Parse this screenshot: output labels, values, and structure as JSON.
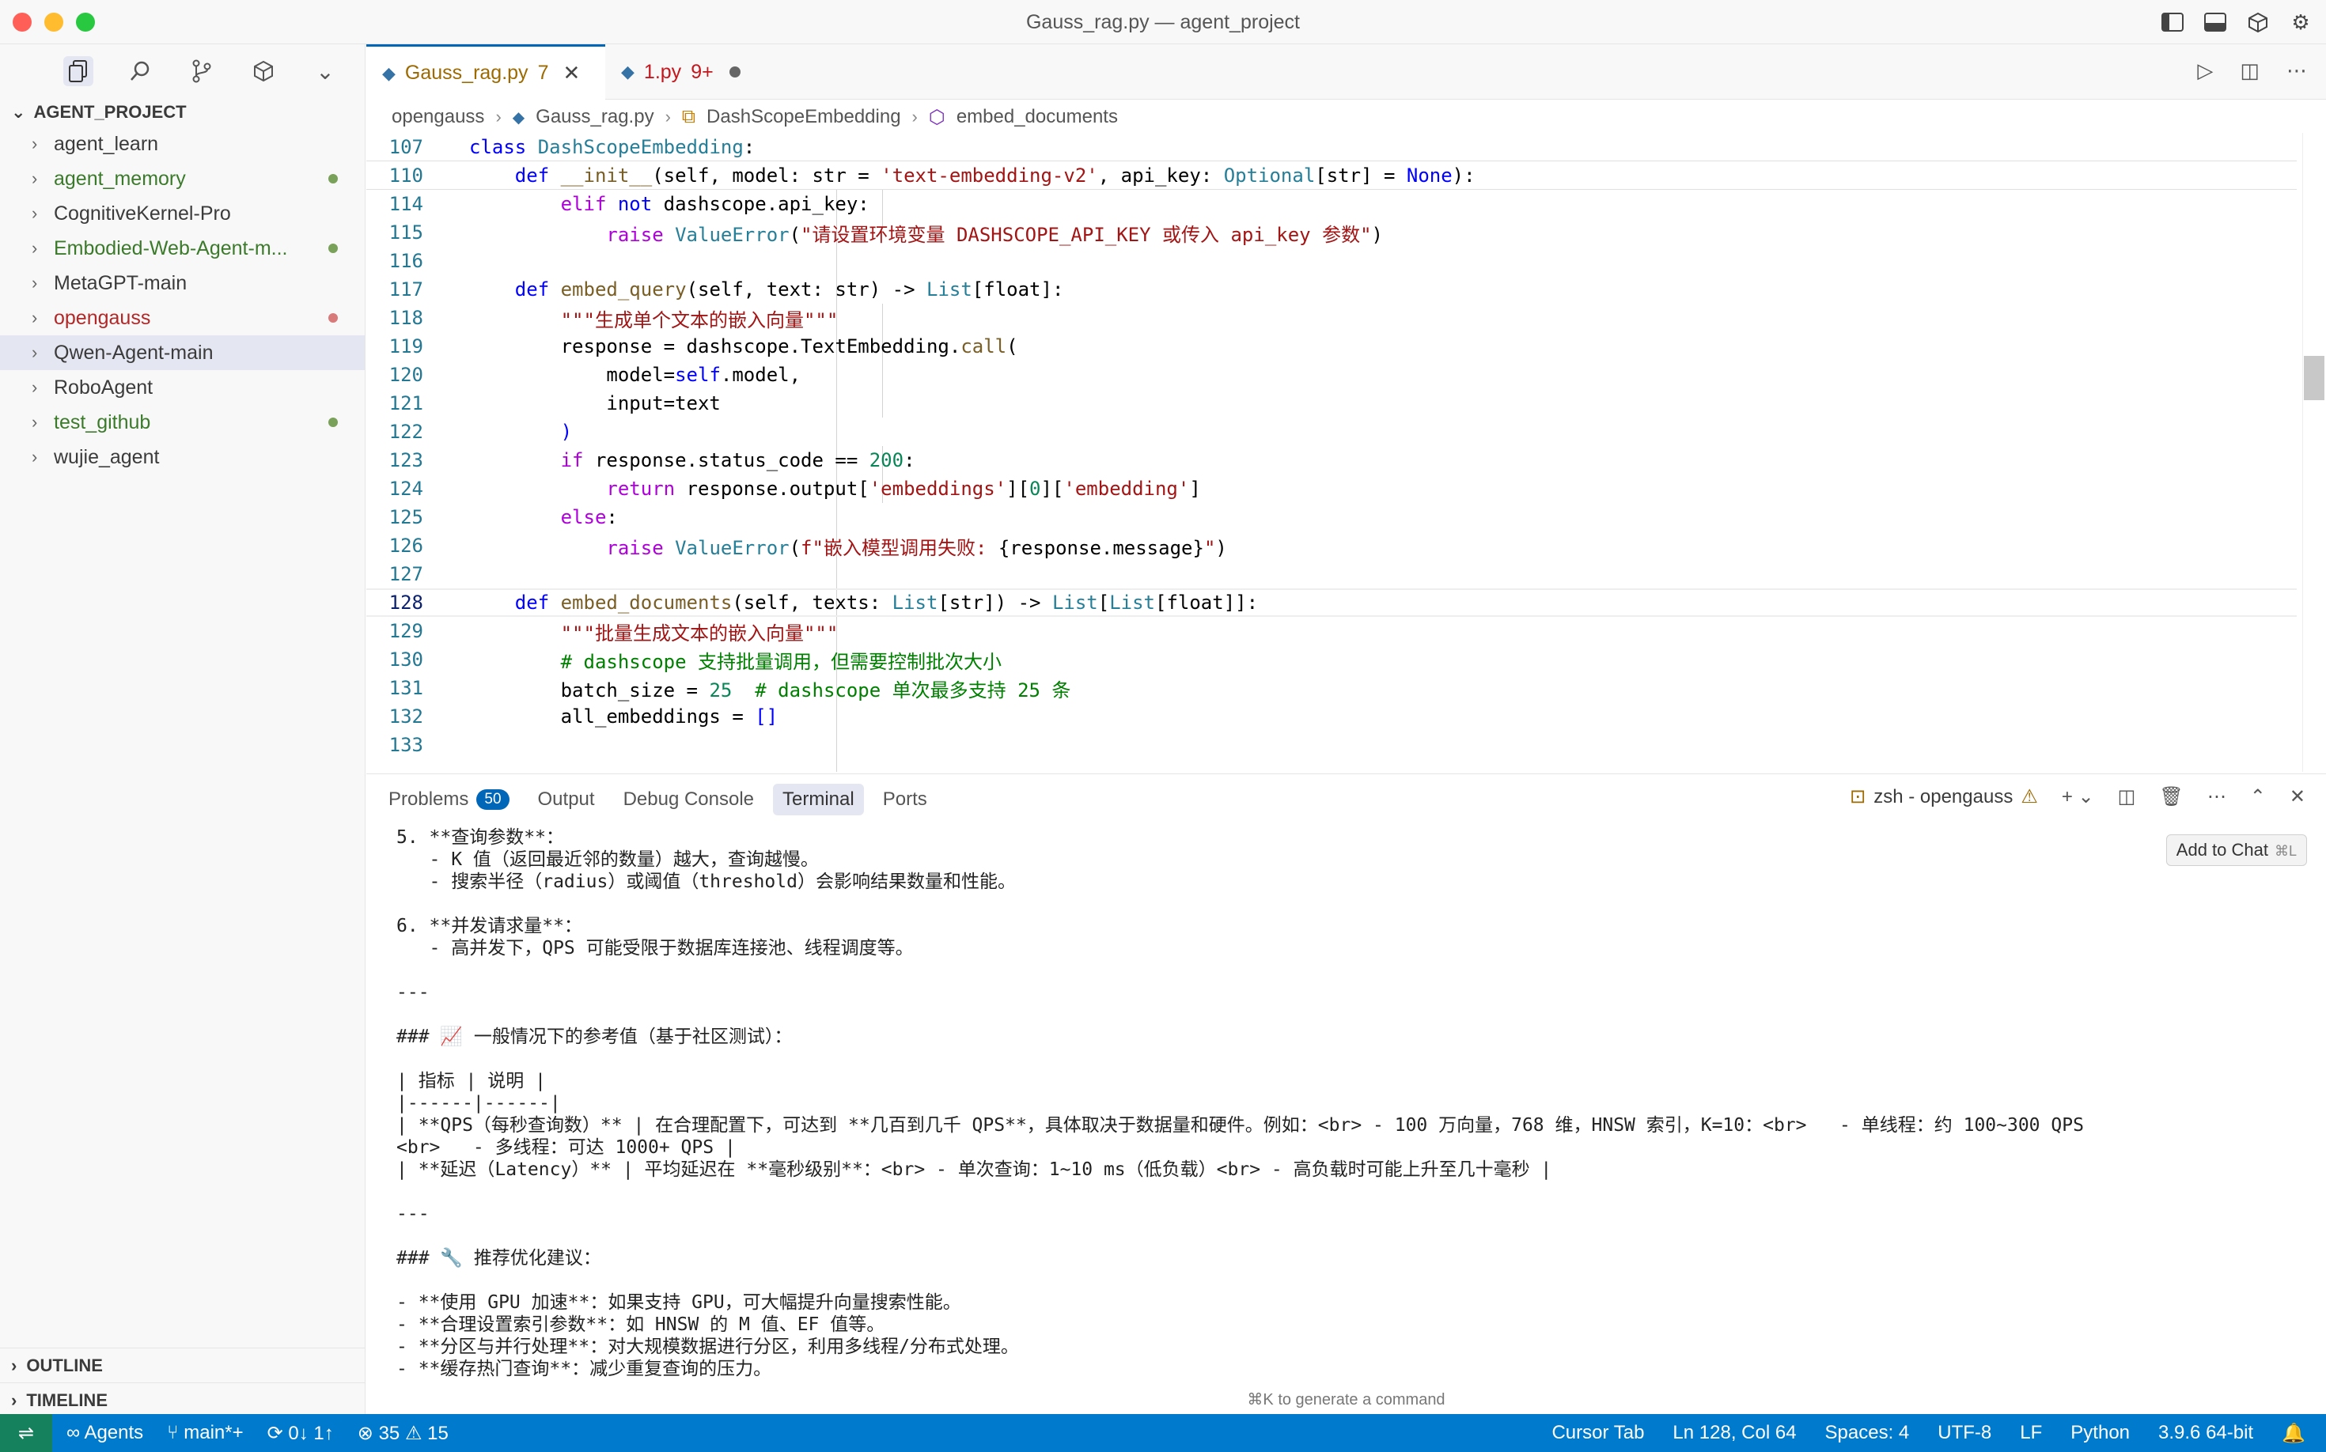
{
  "window": {
    "title": "Gauss_rag.py — agent_project"
  },
  "sidebar": {
    "header": "AGENT_PROJECT",
    "items": [
      {
        "label": "agent_learn",
        "status": "none"
      },
      {
        "label": "agent_memory",
        "status": "modified"
      },
      {
        "label": "CognitiveKernel-Pro",
        "status": "none"
      },
      {
        "label": "Embodied-Web-Agent-m...",
        "status": "modified"
      },
      {
        "label": "MetaGPT-main",
        "status": "none"
      },
      {
        "label": "opengauss",
        "status": "error"
      },
      {
        "label": "Qwen-Agent-main",
        "status": "selected"
      },
      {
        "label": "RoboAgent",
        "status": "none"
      },
      {
        "label": "test_github",
        "status": "modified"
      },
      {
        "label": "wujie_agent",
        "status": "none"
      }
    ],
    "outline": "OUTLINE",
    "timeline": "TIMELINE"
  },
  "tabs": [
    {
      "name": "Gauss_rag.py",
      "count": "7",
      "active": true
    },
    {
      "name": "1.py",
      "count": "9+",
      "active": false
    }
  ],
  "breadcrumb": [
    "opengauss",
    "Gauss_rag.py",
    "DashScopeEmbedding",
    "embed_documents"
  ],
  "editor": {
    "lines": [
      {
        "n": "107",
        "code": "class DashScopeEmbedding:"
      },
      {
        "n": "110",
        "code": "    def __init__(self, model: str = 'text-embedding-v2', api_key: Optional[str] = None):"
      },
      {
        "n": "114",
        "code": "        elif not dashscope.api_key:"
      },
      {
        "n": "115",
        "code": "            raise ValueError(\"请设置环境变量 DASHSCOPE_API_KEY 或传入 api_key 参数\")"
      },
      {
        "n": "116",
        "code": ""
      },
      {
        "n": "117",
        "code": "    def embed_query(self, text: str) -> List[float]:"
      },
      {
        "n": "118",
        "code": "        \"\"\"生成单个文本的嵌入向量\"\"\""
      },
      {
        "n": "119",
        "code": "        response = dashscope.TextEmbedding.call("
      },
      {
        "n": "120",
        "code": "            model=self.model,"
      },
      {
        "n": "121",
        "code": "            input=text"
      },
      {
        "n": "122",
        "code": "        )"
      },
      {
        "n": "123",
        "code": "        if response.status_code == 200:"
      },
      {
        "n": "124",
        "code": "            return response.output['embeddings'][0]['embedding']"
      },
      {
        "n": "125",
        "code": "        else:"
      },
      {
        "n": "126",
        "code": "            raise ValueError(f\"嵌入模型调用失败: {response.message}\")"
      },
      {
        "n": "127",
        "code": ""
      },
      {
        "n": "128",
        "code": "    def embed_documents(self, texts: List[str]) -> List[List[float]]:"
      },
      {
        "n": "129",
        "code": "        \"\"\"批量生成文本的嵌入向量\"\"\""
      },
      {
        "n": "130",
        "code": "        # dashscope 支持批量调用，但需要控制批次大小"
      },
      {
        "n": "131",
        "code": "        batch_size = 25  # dashscope 单次最多支持 25 条"
      },
      {
        "n": "132",
        "code": "        all_embeddings = []"
      },
      {
        "n": "133",
        "code": ""
      }
    ]
  },
  "panel": {
    "tabs": [
      "Problems",
      "Output",
      "Debug Console",
      "Terminal",
      "Ports"
    ],
    "problems_count": "50",
    "terminal_name": "zsh - opengauss",
    "add_to_chat": "Add to Chat",
    "add_to_chat_shortcut": "⌘L",
    "terminal_lines": [
      "5. **查询参数**：",
      "   - K 值（返回最近邻的数量）越大，查询越慢。",
      "   - 搜索半径（radius）或阈值（threshold）会影响结果数量和性能。",
      "",
      "6. **并发请求量**：",
      "   - 高并发下，QPS 可能受限于数据库连接池、线程调度等。",
      "",
      "---",
      "",
      "### 📈 一般情况下的参考值（基于社区测试）：",
      "",
      "| 指标 | 说明 |",
      "|------|------|",
      "| **QPS（每秒查询数）** | 在合理配置下，可达到 **几百到几千 QPS**，具体取决于数据量和硬件。例如：<br> - 100 万向量，768 维，HNSW 索引，K=10：<br>   - 单线程：约 100~300 QPS",
      "<br>   - 多线程：可达 1000+ QPS |",
      "| **延迟（Latency）** | 平均延迟在 **毫秒级别**：<br> - 单次查询：1~10 ms（低负载）<br> - 高负载时可能上升至几十毫秒 |",
      "",
      "---",
      "",
      "### 🔧 推荐优化建议：",
      "",
      "- **使用 GPU 加速**：如果支持 GPU，可大幅提升向量搜索性能。",
      "- **合理设置索引参数**：如 HNSW 的 M 值、EF 值等。",
      "- **分区与并行处理**：对大规模数据进行分区，利用多线程/分布式处理。",
      "- **缓存热门查询**：减少重复查询的压力。"
    ]
  },
  "cmd_hint": "⌘K to generate a command",
  "statusbar": {
    "agents": "Agents",
    "branch": "main*+",
    "sync": "0↓ 1↑",
    "errors": "35",
    "warnings": "15",
    "cursor_tab": "Cursor Tab",
    "position": "Ln 128, Col 64",
    "spaces": "Spaces: 4",
    "encoding": "UTF-8",
    "eol": "LF",
    "language": "Python",
    "interpreter": "3.9.6 64-bit"
  },
  "colors": {
    "accent": "#007acc",
    "remote": "#16825d",
    "tab_active_border": "#0066b8"
  }
}
